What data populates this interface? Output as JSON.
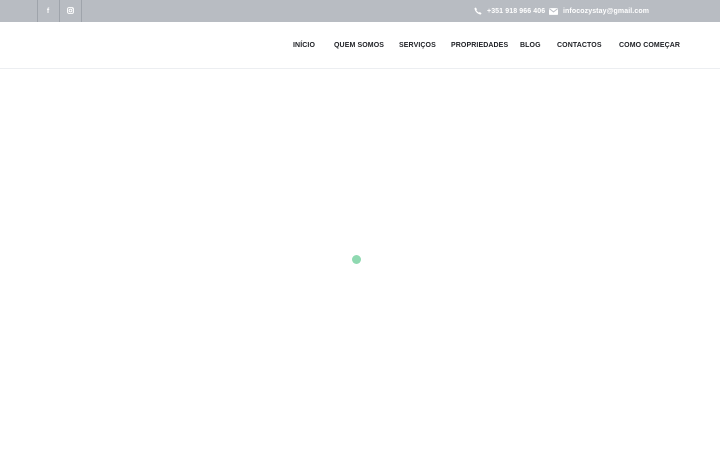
{
  "topbar": {
    "social": [
      {
        "name": "facebook",
        "glyph": "f"
      },
      {
        "name": "instagram",
        "glyph": "◘"
      }
    ],
    "phone": "+351 918 966 406",
    "email": "infocozystay@gmail.com"
  },
  "nav": {
    "items": [
      {
        "label": "INÍCIO"
      },
      {
        "label": "QUEM SOMOS"
      },
      {
        "label": "SERVIÇOS"
      },
      {
        "label": "PROPRIEDADES"
      },
      {
        "label": "BLOG"
      },
      {
        "label": "CONTACTOS"
      },
      {
        "label": "COMO COMEÇAR"
      }
    ]
  },
  "colors": {
    "topbar_bg": "#b8bcc2",
    "loader": "#8fd9b1",
    "nav_text": "#1d1f24"
  },
  "icons": {
    "phone": "phone-icon",
    "email": "envelope-icon",
    "facebook": "facebook-icon",
    "instagram": "instagram-icon"
  }
}
